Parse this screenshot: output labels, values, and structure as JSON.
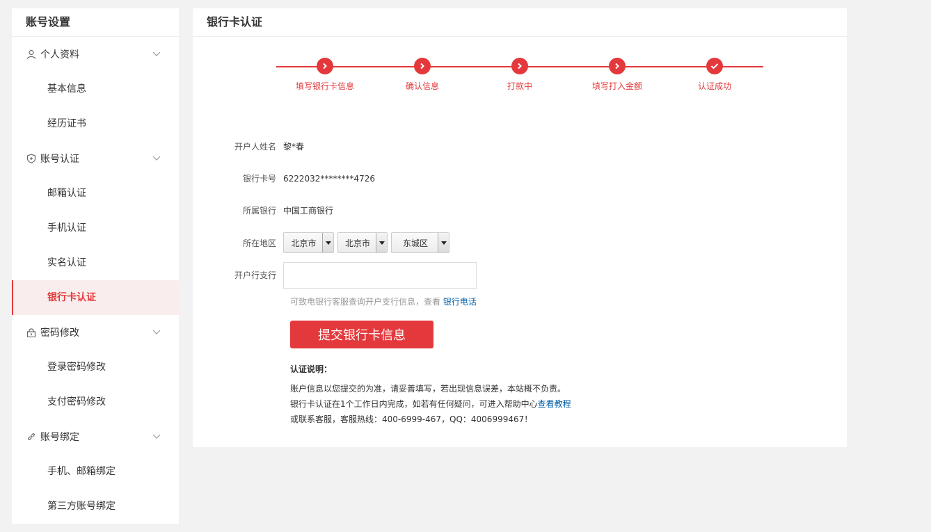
{
  "sidebar": {
    "title": "账号设置",
    "groups": [
      {
        "label": "个人资料",
        "items": [
          "基本信息",
          "经历证书"
        ]
      },
      {
        "label": "账号认证",
        "items": [
          "邮箱认证",
          "手机认证",
          "实名认证",
          "银行卡认证"
        ]
      },
      {
        "label": "密码修改",
        "items": [
          "登录密码修改",
          "支付密码修改"
        ]
      },
      {
        "label": "账号绑定",
        "items": [
          "手机、邮箱绑定",
          "第三方账号绑定"
        ]
      }
    ],
    "active_item": "银行卡认证"
  },
  "main": {
    "title": "银行卡认证",
    "steps": [
      "填写银行卡信息",
      "确认信息",
      "打款中",
      "填写打入金额",
      "认证成功"
    ],
    "accent_color": "#e4393c",
    "form": {
      "name_label": "开户人姓名",
      "name_value": "黎*春",
      "card_label": "银行卡号",
      "card_value": "6222032********4726",
      "bank_label": "所属银行",
      "bank_value": "中国工商银行",
      "region_label": "所在地区",
      "province": "北京市",
      "city": "北京市",
      "district": "东城区",
      "branch_label": "开户行支行",
      "branch_value": "",
      "hint_text": "可致电银行客服查询开户支行信息，查看 ",
      "hint_link": "银行电话",
      "submit_label": "提交银行卡信息"
    },
    "notes": {
      "title": "认证说明：",
      "line1": "账户信息以您提交的为准，请妥善填写，若出现信息误差，本站概不负责。",
      "line2_text": "银行卡认证在1个工作日内完成，如若有任何疑问，可进入帮助中心",
      "line2_link": "查看教程",
      "line3": "或联系客服，客服热线：400-6999-467，QQ：4006999467！"
    }
  }
}
